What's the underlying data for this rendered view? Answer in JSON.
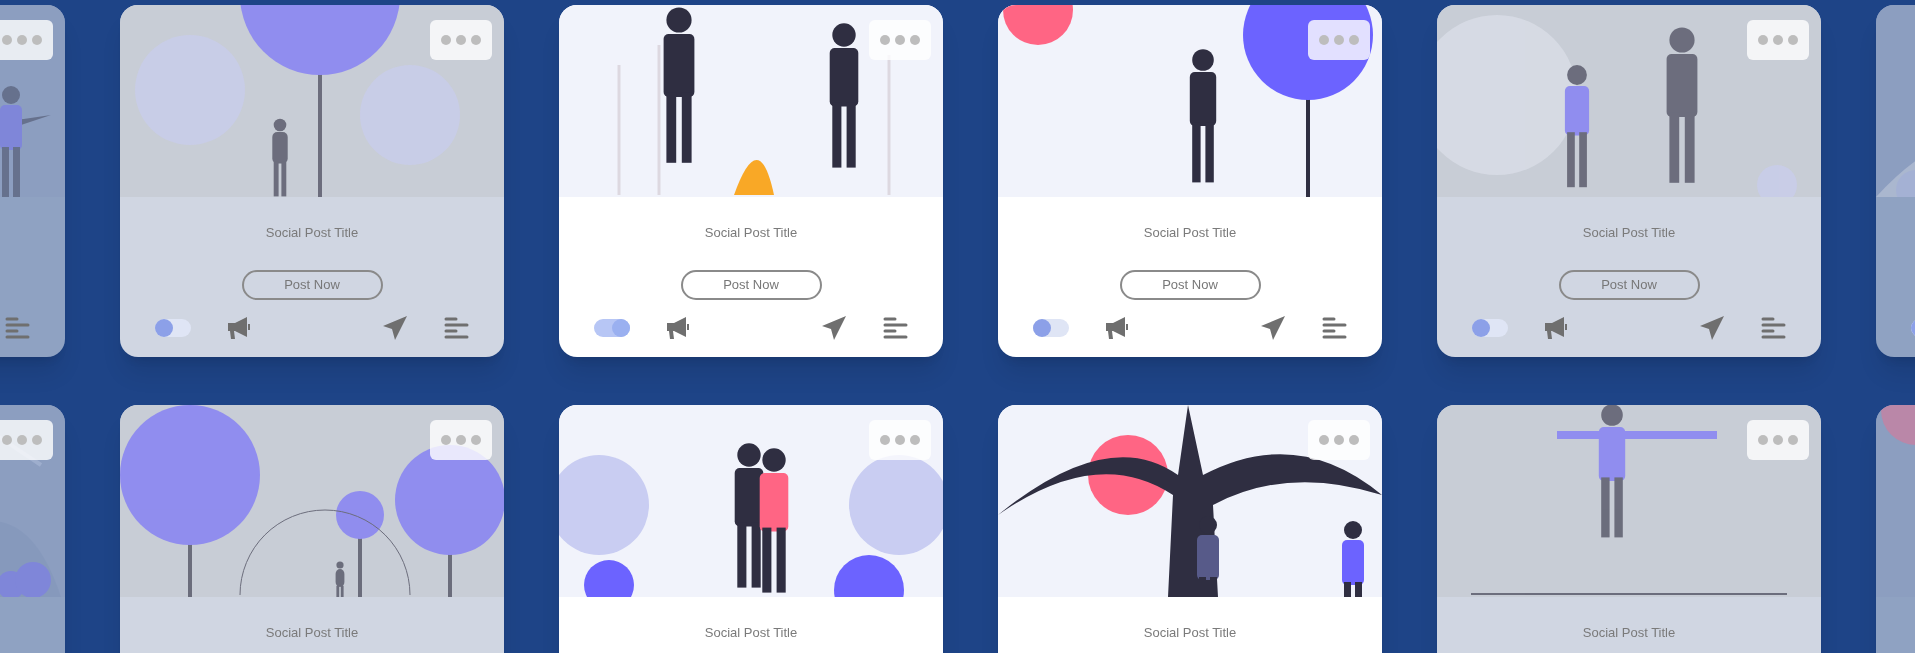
{
  "rows": [
    {
      "cards": [
        {
          "selected": false
        },
        {
          "selected": false,
          "title": "Social Post Title",
          "button": "Post Now",
          "toggle_on": false
        },
        {
          "selected": true,
          "title": "Social Post Title",
          "button": "Post Now",
          "toggle_on": true
        },
        {
          "selected": true,
          "title": "Social Post Title",
          "button": "Post Now",
          "toggle_on": false
        },
        {
          "selected": false,
          "title": "Social Post Title",
          "button": "Post Now",
          "toggle_on": false
        },
        {
          "selected": false,
          "toggle_on": false
        }
      ]
    },
    {
      "cards": [
        {
          "selected": false
        },
        {
          "selected": false,
          "title": "Social Post Title"
        },
        {
          "selected": true,
          "title": "Social Post Title"
        },
        {
          "selected": true,
          "title": "Social Post Title"
        },
        {
          "selected": false,
          "title": "Social Post Title"
        },
        {
          "selected": false
        }
      ]
    }
  ]
}
